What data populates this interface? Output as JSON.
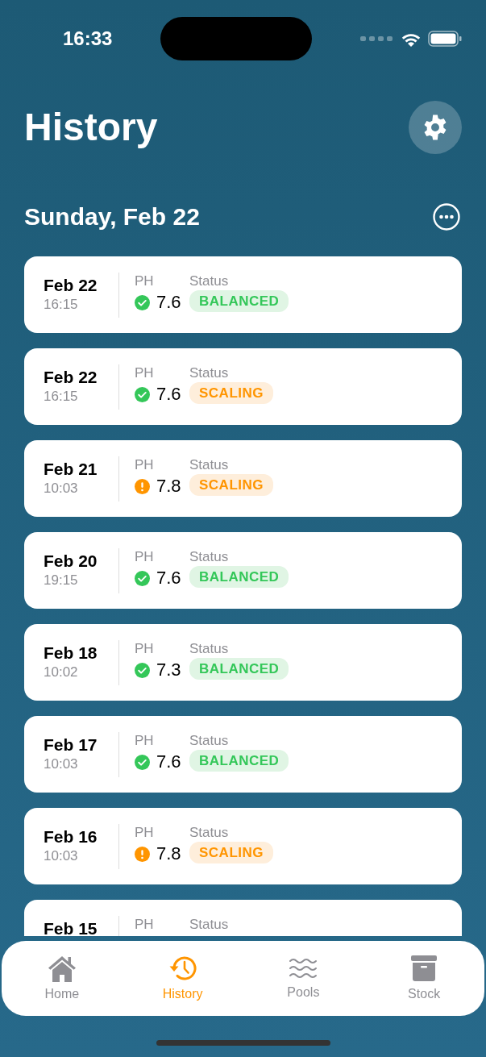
{
  "status_bar": {
    "time": "16:33"
  },
  "header": {
    "title": "History"
  },
  "section": {
    "title": "Sunday, Feb 22"
  },
  "entries": [
    {
      "date": "Feb 22",
      "time": "16:15",
      "ph_label": "PH",
      "ph_ok": true,
      "ph_value": "7.6",
      "status_label": "Status",
      "status": {
        "text": "BALANCED",
        "kind": "balanced"
      }
    },
    {
      "date": "Feb 22",
      "time": "16:15",
      "ph_label": "PH",
      "ph_ok": true,
      "ph_value": "7.6",
      "status_label": "Status",
      "status": {
        "text": "SCALING",
        "kind": "scaling"
      }
    },
    {
      "date": "Feb 21",
      "time": "10:03",
      "ph_label": "PH",
      "ph_ok": false,
      "ph_value": "7.8",
      "status_label": "Status",
      "status": {
        "text": "SCALING",
        "kind": "scaling"
      }
    },
    {
      "date": "Feb 20",
      "time": "19:15",
      "ph_label": "PH",
      "ph_ok": true,
      "ph_value": "7.6",
      "status_label": "Status",
      "status": {
        "text": "BALANCED",
        "kind": "balanced"
      }
    },
    {
      "date": "Feb 18",
      "time": "10:02",
      "ph_label": "PH",
      "ph_ok": true,
      "ph_value": "7.3",
      "status_label": "Status",
      "status": {
        "text": "BALANCED",
        "kind": "balanced"
      }
    },
    {
      "date": "Feb 17",
      "time": "10:03",
      "ph_label": "PH",
      "ph_ok": true,
      "ph_value": "7.6",
      "status_label": "Status",
      "status": {
        "text": "BALANCED",
        "kind": "balanced"
      }
    },
    {
      "date": "Feb 16",
      "time": "10:03",
      "ph_label": "PH",
      "ph_ok": false,
      "ph_value": "7.8",
      "status_label": "Status",
      "status": {
        "text": "SCALING",
        "kind": "scaling"
      }
    },
    {
      "date": "Feb 15",
      "ph_label": "PH",
      "status_label": "Status"
    }
  ],
  "tabs": [
    {
      "label": "Home",
      "selected": false
    },
    {
      "label": "History",
      "selected": true
    },
    {
      "label": "Pools",
      "selected": false
    },
    {
      "label": "Stock",
      "selected": false
    }
  ]
}
